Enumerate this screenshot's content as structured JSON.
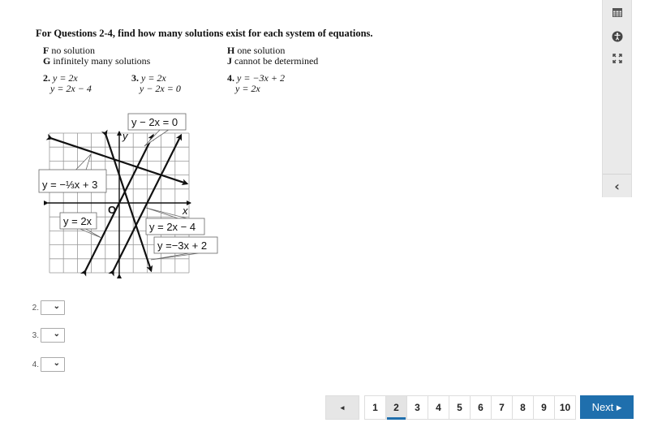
{
  "instructions": "For Questions 2-4, find how many solutions exist for each system of equations.",
  "choices": [
    {
      "letter": "F",
      "text": "no solution"
    },
    {
      "letter": "G",
      "text": "infinitely many solutions"
    },
    {
      "letter": "H",
      "text": "one solution"
    },
    {
      "letter": "J",
      "text": "cannot be determined"
    }
  ],
  "systems": [
    {
      "num": "2.",
      "eq1": "y = 2x",
      "eq2": "y = 2x − 4"
    },
    {
      "num": "3.",
      "eq1": "y = 2x",
      "eq2": "y − 2x = 0"
    },
    {
      "num": "4.",
      "eq1": "y = −3x + 2",
      "eq2": "y = 2x"
    }
  ],
  "graph": {
    "x_axis_label": "x",
    "y_axis_label": "y",
    "origin_label": "O",
    "labels": {
      "line_neg_third": "y = −⅓x + 3",
      "line_y_minus_2x": "y − 2x = 0",
      "line_2x": "y = 2x",
      "line_2x_minus_4": "y = 2x − 4",
      "line_neg3x_plus_2": "y =−3x + 2"
    },
    "lines": [
      {
        "id": "line_neg_third",
        "slope": -0.3333,
        "intercept": 3
      },
      {
        "id": "line_2x",
        "slope": 2,
        "intercept": 0
      },
      {
        "id": "line_2x_minus_4",
        "slope": 2,
        "intercept": -4
      },
      {
        "id": "line_neg3x_plus_2",
        "slope": -3,
        "intercept": 2
      }
    ],
    "range": [
      -5,
      5
    ]
  },
  "answers": [
    {
      "label": "2.",
      "value": ""
    },
    {
      "label": "3.",
      "value": ""
    },
    {
      "label": "4.",
      "value": ""
    }
  ],
  "sidebar": {
    "icons": [
      "calculator-icon",
      "accessibility-icon",
      "fullscreen-icon"
    ],
    "collapse": "‹"
  },
  "pagination": {
    "prev": "◂",
    "pages": [
      "1",
      "2",
      "3",
      "4",
      "5",
      "6",
      "7",
      "8",
      "9",
      "10"
    ],
    "current": "2",
    "next": "Next ▸"
  }
}
